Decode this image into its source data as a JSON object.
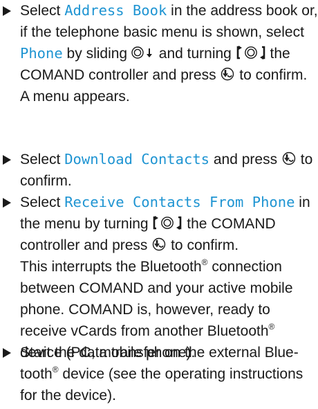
{
  "steps": [
    {
      "t1": "Select ",
      "c1": "Address Book",
      "t2": " in the address book or, if the telephone basic menu is shown, select ",
      "c2": "Phone",
      "t3": " by sliding ",
      "t4": " and turning ",
      "t5": " the COMAND controller and press ",
      "t6": " to confirm.",
      "result": "A menu appears."
    },
    {
      "t1": "Select ",
      "c1": "Download Contacts",
      "t2": " and press ",
      "t3": " to confirm."
    },
    {
      "t1": "Select ",
      "c1": "Receive Contacts From Phone",
      "t2": " in the menu by turning ",
      "t3": " the COMAND controller and press ",
      "t4": " to confirm.",
      "r1": "This interrupts the Bluetooth",
      "reg": "®",
      "r2": " connection between COMAND and your active mobile phone. COMAND is, however, ready to receive vCards from another Bluetooth",
      "r3": " device (PC, mobile phone)."
    },
    {
      "t1": "Start the data transfer on the external Blue-tooth",
      "reg": "®",
      "t2": " device (see the operating instructions for the device)."
    }
  ],
  "icons": [
    "bullet-triangle-icon",
    "slide-down-icon",
    "turn-controller-icon",
    "press-controller-icon"
  ]
}
